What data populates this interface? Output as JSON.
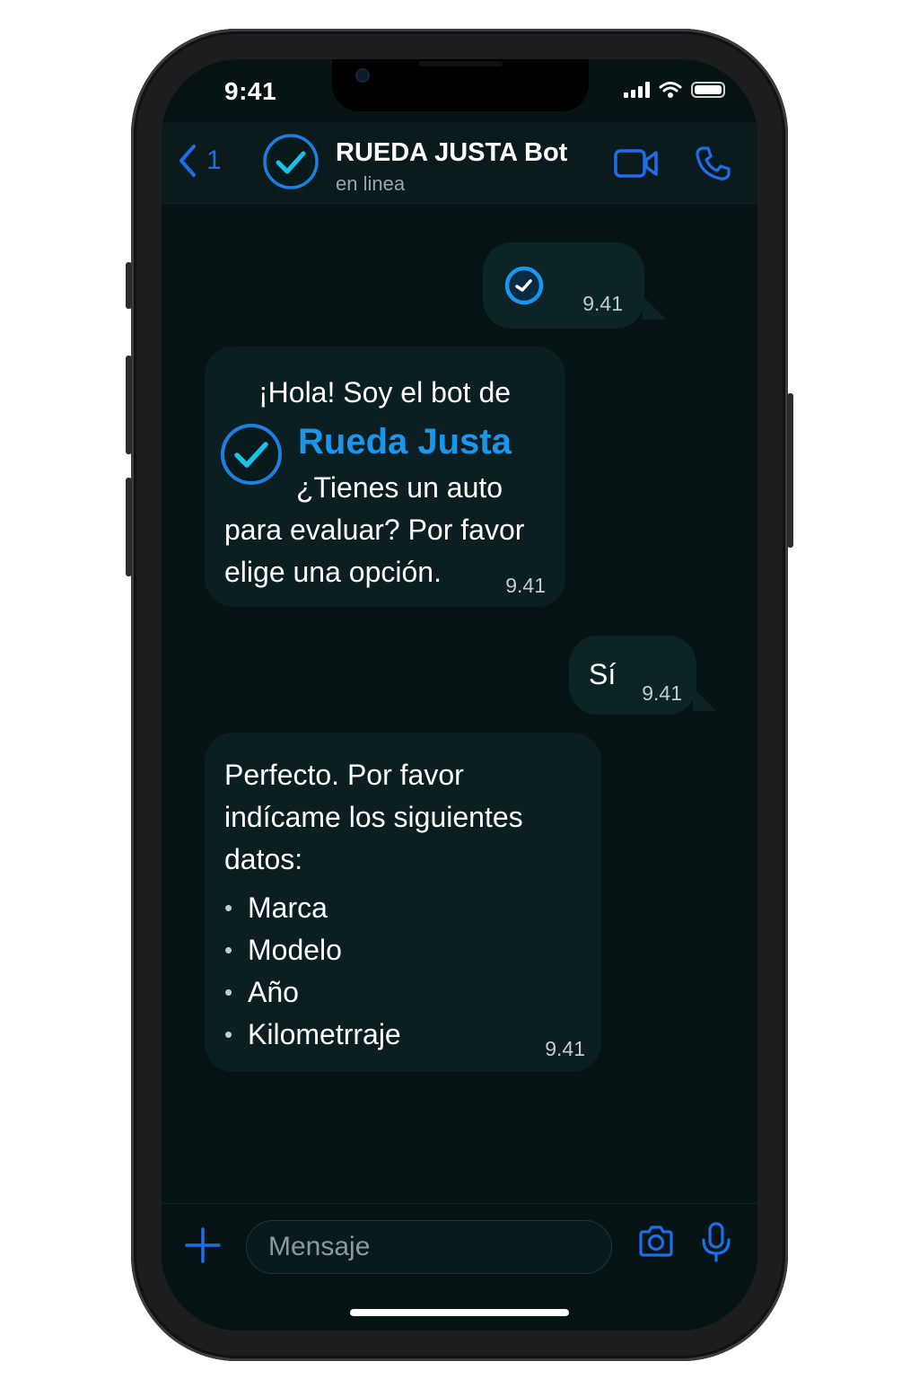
{
  "status_bar": {
    "time": "9:41",
    "icons": [
      "signal-icon",
      "wifi-icon",
      "battery-icon"
    ]
  },
  "header": {
    "back_count": "1",
    "contact_name": "RUEDA JUSTA Bot",
    "contact_status": "en linea",
    "icons": [
      "back-chevron-icon",
      "checkmark-avatar-icon",
      "video-camera-icon",
      "phone-icon"
    ]
  },
  "messages": [
    {
      "direction": "outgoing",
      "content": "clock-icon",
      "time": "9.41"
    },
    {
      "direction": "incoming",
      "line1": "¡Hola! Soy el bot de",
      "brand": "Rueda Justa",
      "line2": "¿Tienes un auto",
      "line3": "para evaluar? Por favor",
      "line4": "elige una opción.",
      "time": "9.41"
    },
    {
      "direction": "outgoing",
      "text": "Sí",
      "time": "9.41"
    },
    {
      "direction": "incoming",
      "line1": "Perfecto. Por favor",
      "line2": "indícame los siguientes",
      "line3": "datos:",
      "items": [
        "Marca",
        "Modelo",
        "Año",
        "Kilometrraje"
      ],
      "time": "9.41"
    }
  ],
  "composer": {
    "placeholder": "Mensaje",
    "icons": [
      "plus-icon",
      "camera-icon",
      "microphone-icon"
    ]
  },
  "colors": {
    "accent": "#1e6ee8",
    "brand": "#1a96ea",
    "background": "#071416",
    "bubble": "#0d2427"
  }
}
